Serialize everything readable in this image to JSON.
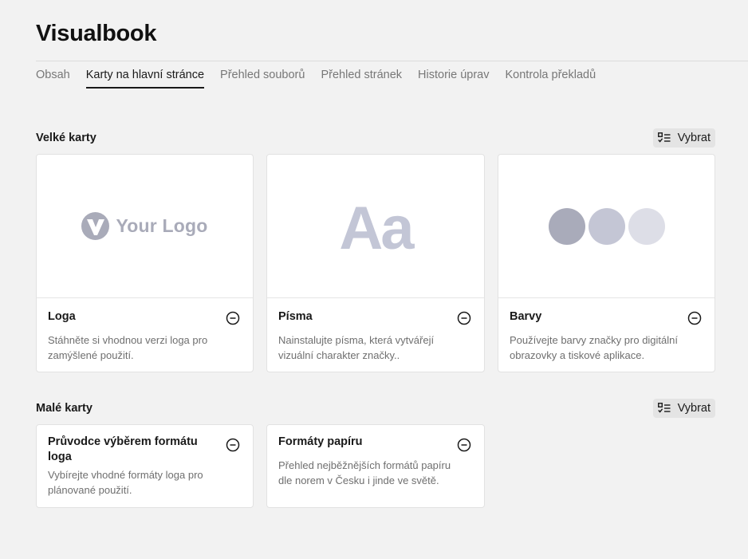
{
  "app": {
    "title": "Visualbook"
  },
  "tabs": [
    {
      "label": "Obsah",
      "active": false
    },
    {
      "label": "Karty na hlavní stránce",
      "active": true
    },
    {
      "label": "Přehled souborů",
      "active": false
    },
    {
      "label": "Přehled stránek",
      "active": false
    },
    {
      "label": "Historie úprav",
      "active": false
    },
    {
      "label": "Kontrola překladů",
      "active": false
    }
  ],
  "large_section": {
    "title": "Velké karty",
    "select_label": "Vybrat",
    "cards": [
      {
        "title": "Loga",
        "description": "Stáhněte si vhodnou verzi loga pro zamýšlené použití.",
        "preview_text": "Your Logo"
      },
      {
        "title": "Písma",
        "description": "Nainstalujte písma, která vytvářejí vizuální charakter značky..",
        "preview_text": "Aa"
      },
      {
        "title": "Barvy",
        "description": "Používejte barvy značky pro digitální obrazovky a tiskové aplikace.",
        "swatches": [
          "#a9abba",
          "#c4c6d5",
          "#dddee7"
        ]
      }
    ]
  },
  "small_section": {
    "title": "Malé karty",
    "select_label": "Vybrat",
    "cards": [
      {
        "title": "Průvodce výběrem formátu loga",
        "description": "Vybírejte vhodné formáty loga pro plánované použití."
      },
      {
        "title": "Formáty papíru",
        "description": "Přehled nejběžnějších formátů papíru dle norem v Česku i jinde ve světě."
      }
    ]
  },
  "colors": {
    "accent": "#1a1a1a",
    "muted": "#777777",
    "background": "#f2f2f2"
  }
}
